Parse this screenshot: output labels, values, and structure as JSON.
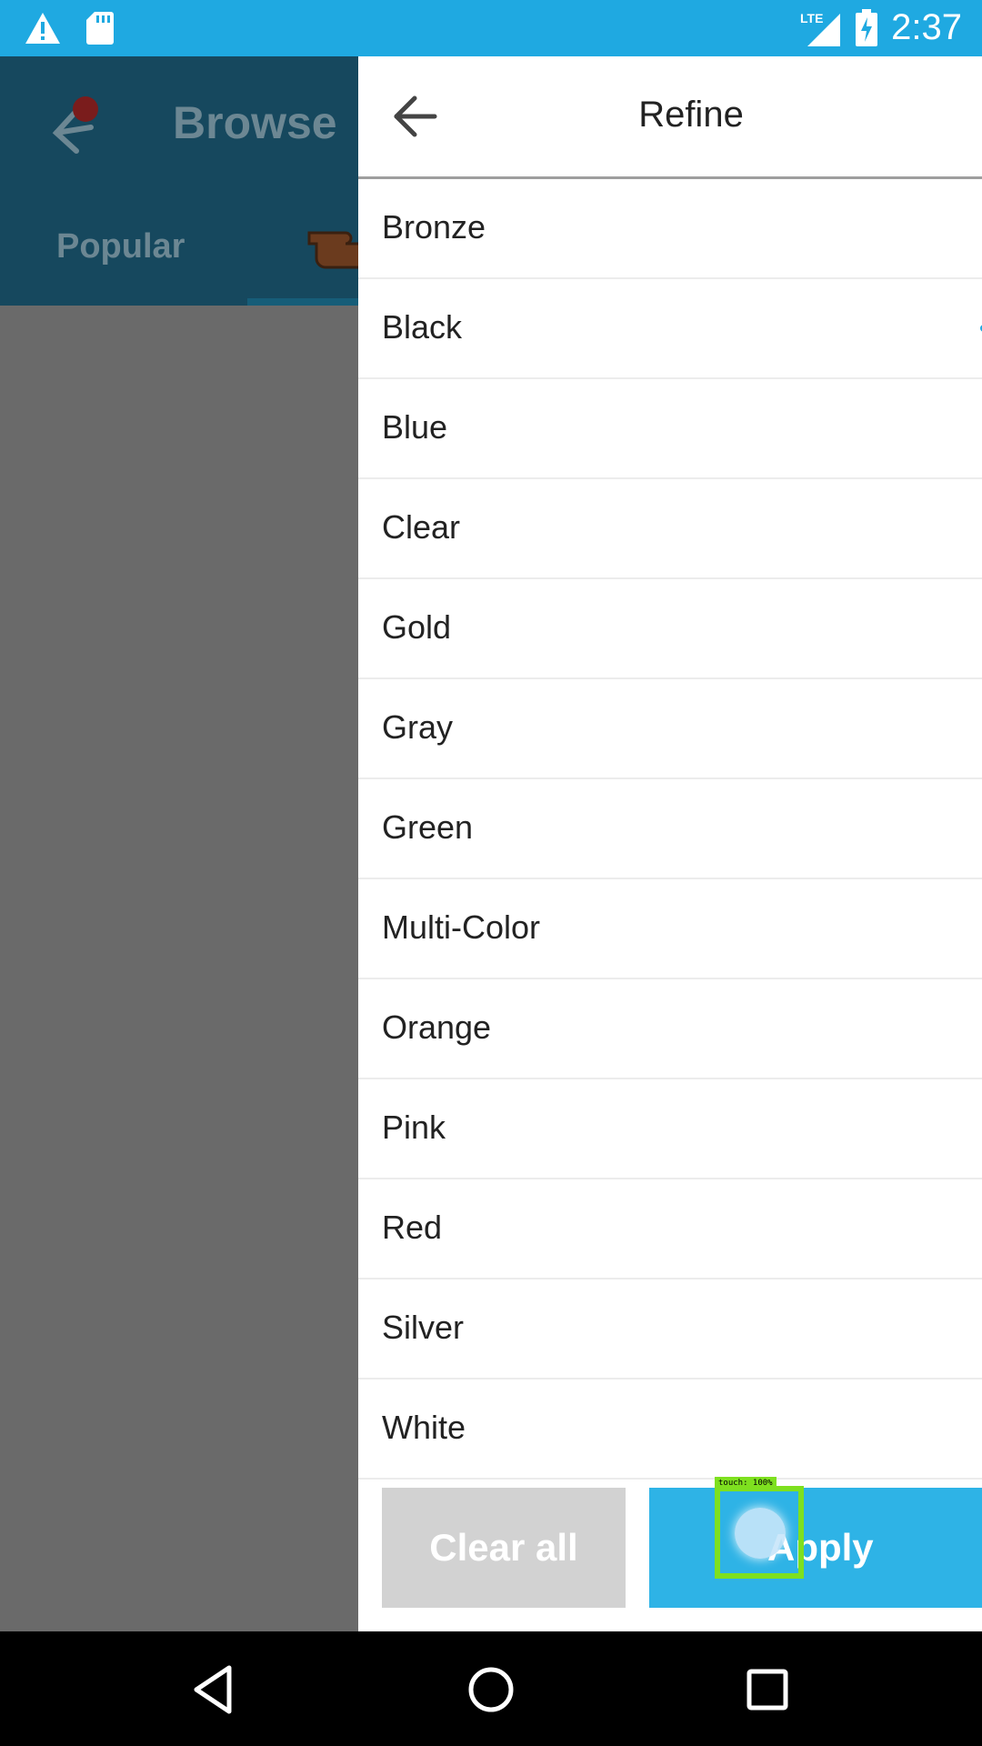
{
  "status_bar": {
    "time": "2:37",
    "network": "LTE",
    "icons": [
      "warning-icon",
      "sd-card-icon",
      "lte-signal-icon",
      "battery-charging-icon"
    ]
  },
  "background_app": {
    "title": "Browse",
    "tab_label": "Popular"
  },
  "drawer": {
    "title": "Refine",
    "colors": [
      "Bronze",
      "Black",
      "Blue",
      "Clear",
      "Gold",
      "Gray",
      "Green",
      "Multi-Color",
      "Orange",
      "Pink",
      "Red",
      "Silver",
      "White"
    ],
    "clear_label": "Clear all",
    "apply_label": "Apply"
  },
  "touch_overlay": {
    "label": "touch: 100%"
  },
  "colors": {
    "accent": "#1fa9e1",
    "apply_button": "#2eb3e6",
    "clear_button": "#d2d2d2",
    "toolbar_dimmed": "#16485e"
  }
}
